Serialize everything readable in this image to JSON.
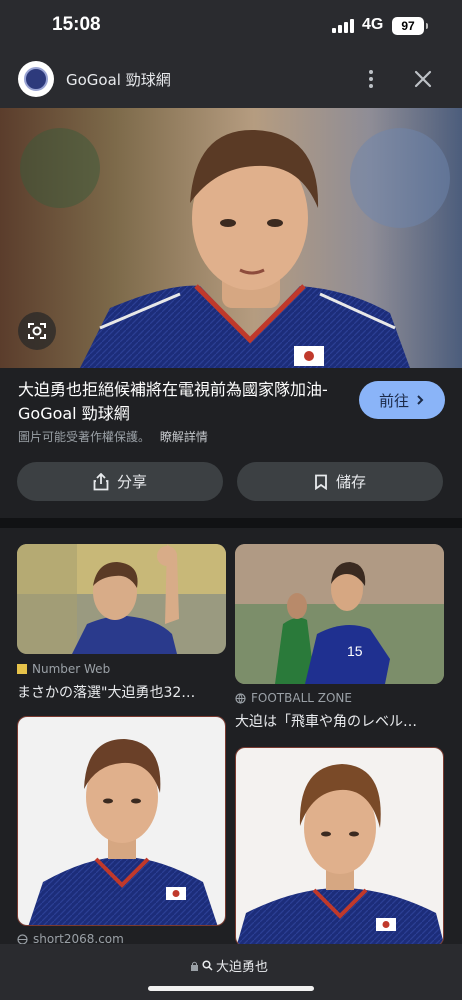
{
  "status": {
    "time": "15:08",
    "network": "4G",
    "battery": "97"
  },
  "header": {
    "site_name": "GoGoal 勁球網",
    "more_icon": "more-vert-icon",
    "close_icon": "close-icon"
  },
  "result": {
    "title": "大迫勇也拒絕候補將在電視前為國家隊加油- GoGoal 勁球網",
    "visit_label": "前往",
    "copyright_note": "圖片可能受著作權保護。",
    "learn_more": "瞭解詳情",
    "share_label": "分享",
    "save_label": "儲存"
  },
  "related": [
    {
      "source": "Number Web",
      "caption": "まさかの落選\"大迫勇也32…"
    },
    {
      "source": "FOOTBALL ZONE",
      "caption": "大迫は「飛車や角のレベル…"
    },
    {
      "source": "short2068.com",
      "caption": ""
    },
    {
      "source": "",
      "caption": ""
    }
  ],
  "jersey_number": "15",
  "bottom": {
    "query": "大迫勇也"
  },
  "colors": {
    "accent": "#8ab4f8",
    "background": "#1f2023",
    "panel": "#2a2b2f"
  }
}
